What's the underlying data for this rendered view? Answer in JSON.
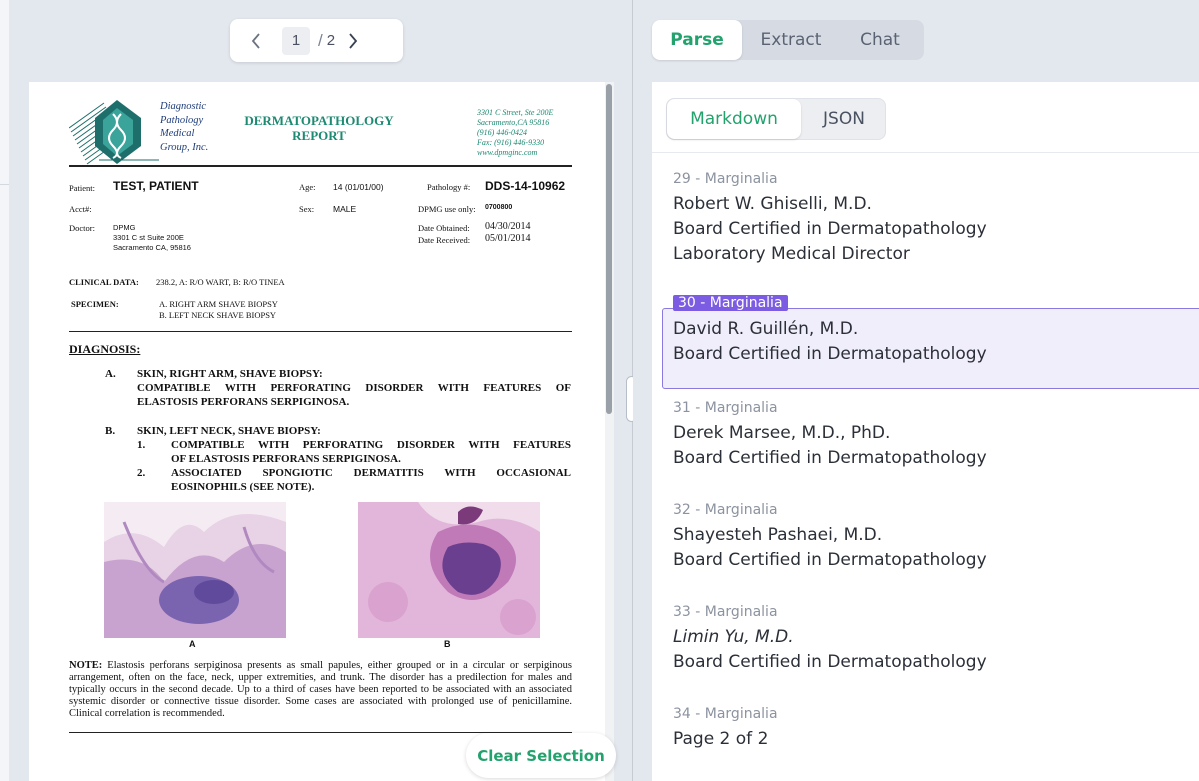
{
  "pager": {
    "current": "1",
    "separator": "/",
    "total": "2"
  },
  "document": {
    "logo_lines": [
      "Diagnostic",
      "Pathology",
      "Medical",
      "Group, Inc."
    ],
    "title_line1": "DERMATOPATHOLOGY",
    "title_line2": "REPORT",
    "address": [
      "3301 C Street, Ste 200E",
      "Sacramento,CA 95816",
      "(916) 446-0424",
      "Fax: (916) 446-9330",
      "www.dpmginc.com"
    ],
    "patient_label": "Patient:",
    "patient_value": "TEST, PATIENT",
    "age_label": "Age:",
    "age_value": "14  (01/01/00)",
    "pathology_label": "Pathology #:",
    "pathology_value": "DDS-14-10962",
    "acct_label": "Acct#:",
    "sex_label": "Sex:",
    "sex_value": "MALE",
    "dpmg_label": "DPMG use only:",
    "dpmg_value": "0700800",
    "doctor_label": "Doctor:",
    "doctor_lines": [
      "DPMG",
      "3301 C st Suite 200E",
      "Sacramento CA, 95816"
    ],
    "obtained_label": "Date Obtained:",
    "obtained_value": "04/30/2014",
    "received_label": "Date Received:",
    "received_value": "05/01/2014",
    "clinical_label": "CLINICAL DATA:",
    "clinical_value": "238.2, A: R/O WART, B: R/O TINEA",
    "specimen_label": "SPECIMEN:",
    "specimen_lines": [
      "A. RIGHT ARM SHAVE BIOPSY",
      "B. LEFT NECK SHAVE BIOPSY"
    ],
    "diagnosis_heading": "DIAGNOSIS:",
    "diag_a_letter": "A.",
    "diag_a_title": "SKIN, RIGHT ARM, SHAVE BIOPSY:",
    "diag_a_line1": "COMPATIBLE WITH PERFORATING DISORDER WITH FEATURES OF",
    "diag_a_line2": "ELASTOSIS PERFORANS SERPIGINOSA.",
    "diag_b_letter": "B.",
    "diag_b_title": "SKIN, LEFT NECK, SHAVE BIOPSY:",
    "diag_b1_num": "1.",
    "diag_b1_line1": "COMPATIBLE WITH PERFORATING DISORDER WITH FEATURES",
    "diag_b1_line2": "OF ELASTOSIS PERFORANS SERPIGINOSA.",
    "diag_b2_num": "2.",
    "diag_b2_line1": "ASSOCIATED SPONGIOTIC DERMATITIS WITH OCCASIONAL",
    "diag_b2_line2": "EOSINOPHILS (SEE NOTE).",
    "image_a_caption": "A",
    "image_b_caption": "B",
    "note_label": "NOTE:",
    "note_text": "Elastosis perforans serpiginosa presents as small papules, either grouped or in a circular or serpiginous arrangement, often on the face, neck, upper extremities, and trunk. The disorder has a predilection for males and typically occurs in the second decade. Up to a third of cases have been reported to be associated with an associated systemic disorder or connective tissue disorder. Some cases are associated with prolonged use of penicillamine.  Clinical correlation is recommended."
  },
  "clear_selection_label": "Clear Selection",
  "main_tabs": [
    {
      "label": "Parse",
      "active": true
    },
    {
      "label": "Extract",
      "active": false
    },
    {
      "label": "Chat",
      "active": false
    }
  ],
  "sub_tabs": [
    {
      "label": "Markdown",
      "active": true
    },
    {
      "label": "JSON",
      "active": false
    }
  ],
  "blocks": [
    {
      "tag": "29 - Marginalia",
      "lines": [
        "Robert W. Ghiselli, M.D.",
        "Board Certified in Dermatopathology",
        "Laboratory Medical Director"
      ],
      "selected": false
    },
    {
      "tag": "30 - Marginalia",
      "lines": [
        "David R. Guillén, M.D.",
        "Board Certified in Dermatopathology"
      ],
      "selected": true
    },
    {
      "tag": "31 - Marginalia",
      "lines": [
        "Derek Marsee, M.D., PhD.",
        "Board Certified in Dermatopathology"
      ],
      "selected": false
    },
    {
      "tag": "32 - Marginalia",
      "lines": [
        "Shayesteh Pashaei, M.D.",
        "Board Certified in Dermatopathology"
      ],
      "selected": false
    },
    {
      "tag": "33 - Marginalia",
      "lines": [
        "Limin Yu, M.D.",
        "Board Certified in Dermatopathology"
      ],
      "selected": false
    },
    {
      "tag": "34 - Marginalia",
      "lines": [
        "Page 2 of 2"
      ],
      "selected": false
    }
  ],
  "colors": {
    "accent_green": "#23a26d",
    "selection_purple": "#7c5ce3",
    "doc_teal": "#1d8a72"
  }
}
